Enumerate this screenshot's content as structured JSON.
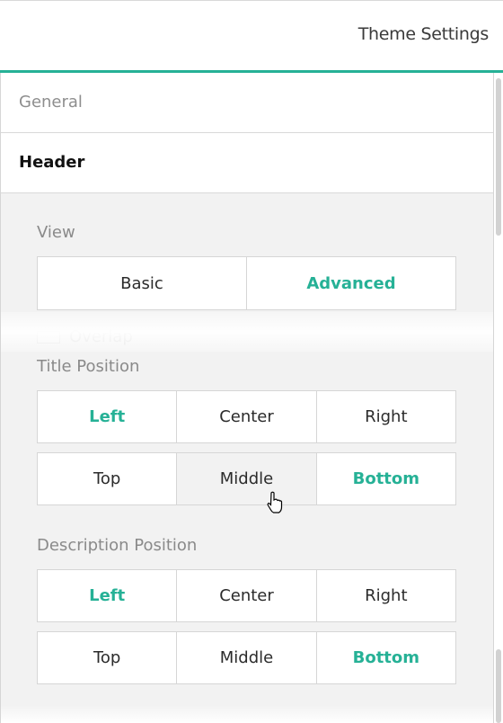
{
  "header": {
    "title": "Theme Settings"
  },
  "tabs": [
    {
      "label": "General",
      "active": false
    },
    {
      "label": "Header",
      "active": true
    }
  ],
  "accent_color": "#26b196",
  "view": {
    "label": "View",
    "options": [
      "Basic",
      "Advanced"
    ],
    "selected": "Advanced"
  },
  "overlap": {
    "label": "Overlap",
    "checked": false
  },
  "title_position": {
    "label": "Title Position",
    "horizontal": [
      "Left",
      "Center",
      "Right"
    ],
    "horizontal_selected": "Left",
    "vertical": [
      "Top",
      "Middle",
      "Bottom"
    ],
    "vertical_selected": "Bottom",
    "hovered": "Middle"
  },
  "description_position": {
    "label": "Description Position",
    "horizontal": [
      "Left",
      "Center",
      "Right"
    ],
    "horizontal_selected": "Left",
    "vertical": [
      "Top",
      "Middle",
      "Bottom"
    ],
    "vertical_selected": "Bottom"
  }
}
